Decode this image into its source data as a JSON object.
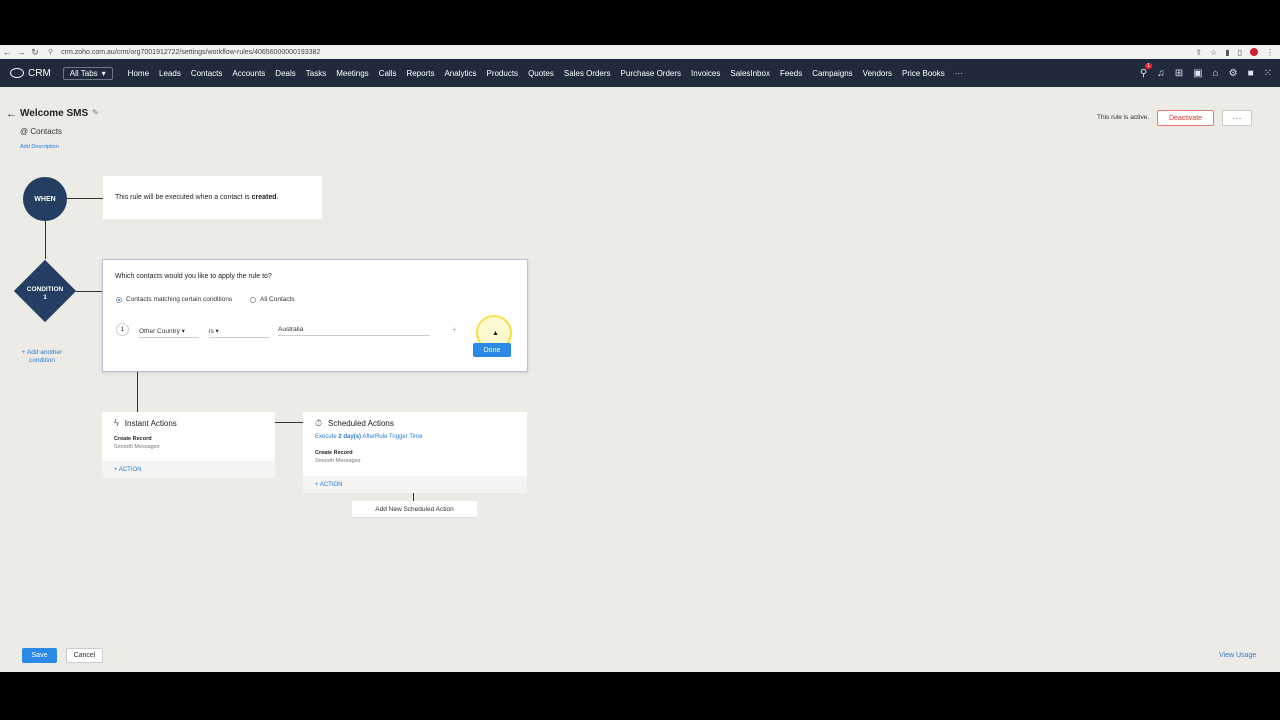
{
  "browser": {
    "url": "crm.zoho.com.au/crm/org7001912722/settings/workflow-rules/40656000000193382"
  },
  "nav": {
    "logo_text": "CRM",
    "all_tabs": "All Tabs",
    "items": [
      "Home",
      "Leads",
      "Contacts",
      "Accounts",
      "Deals",
      "Tasks",
      "Meetings",
      "Calls",
      "Reports",
      "Analytics",
      "Products",
      "Quotes",
      "Sales Orders",
      "Purchase Orders",
      "Invoices",
      "SalesInbox",
      "Feeds",
      "Campaigns",
      "Vendors",
      "Price Books"
    ],
    "more": "···",
    "notification_count": "1"
  },
  "header": {
    "title": "Welcome SMS",
    "module_prefix": "@",
    "module": "Contacts",
    "add_description": "Add Description",
    "status_text": "This rule is active.",
    "deactivate_label": "Deactivate",
    "more_label": "···"
  },
  "flow": {
    "when_label": "WHEN",
    "when_text_prefix": "This rule will be executed when a contact is",
    "when_text_bold": "created",
    "when_text_suffix": ".",
    "condition_label_line1": "CONDITION",
    "condition_label_line2": "1",
    "add_condition_line1": "+ Add another",
    "add_condition_line2": "condition",
    "question": "Which contacts would you like to apply the rule to?",
    "option_matching": "Contacts matching certain conditions",
    "option_all": "All Contacts",
    "criteria": {
      "index": "1",
      "field": "Other Country",
      "operator": "is",
      "value": "Australia"
    },
    "done_label": "Done",
    "instant": {
      "title": "Instant Actions",
      "item_title": "Create Record",
      "item_sub": "Smooth Messages",
      "action_link": "+ ACTION"
    },
    "scheduled": {
      "title": "Scheduled Actions",
      "schedule_prefix": "Execute",
      "schedule_bold": "2 day(s)",
      "schedule_suffix": "AfterRule Trigger Time",
      "item_title": "Create Record",
      "item_sub": "Smooth Messages",
      "action_link": "+ ACTION"
    },
    "add_scheduled": "Add New Scheduled Action"
  },
  "footer": {
    "save_label": "Save",
    "cancel_label": "Cancel",
    "view_usage": "View Usage"
  }
}
